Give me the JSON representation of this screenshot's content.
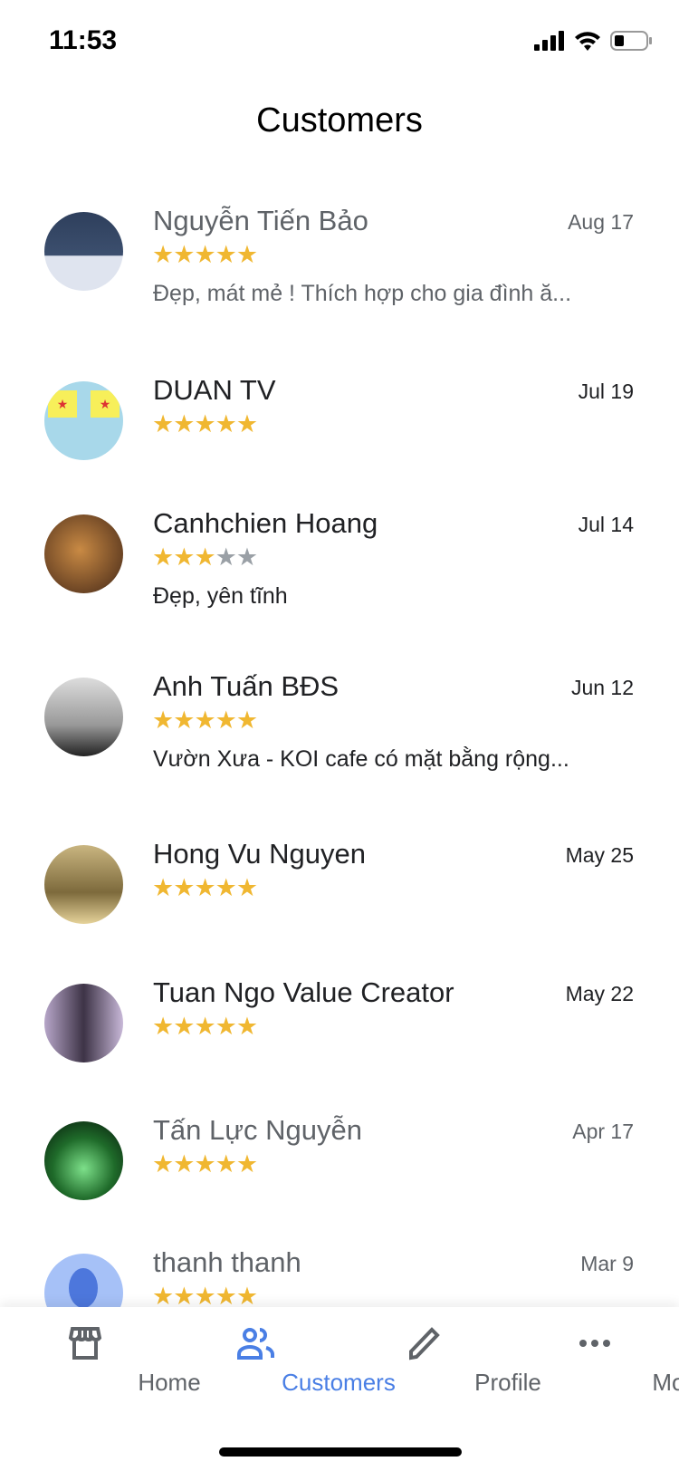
{
  "status_bar": {
    "time": "11:53"
  },
  "header": {
    "title": "Customers"
  },
  "colors": {
    "accent": "#4a7fe5",
    "star": "#f0b731",
    "star_empty": "#9aa0a6"
  },
  "customers": [
    {
      "name": "Nguyễn Tiến Bảo",
      "date": "Aug 17",
      "rating": 5,
      "review": "Đẹp, mát mẻ ! Thích hợp cho gia đình ă...",
      "style": "muted",
      "avatar": "photo-man-brick-wall"
    },
    {
      "name": "DUAN TV",
      "date": "Jul 19",
      "rating": 5,
      "review": "",
      "style": "dark",
      "avatar": "yellow-flags-red-stars"
    },
    {
      "name": "Canhchien Hoang",
      "date": "Jul 14",
      "rating": 3,
      "review": "Đẹp, yên tĩnh",
      "style": "dark",
      "avatar": "photo-tiger"
    },
    {
      "name": "Anh Tuấn BĐS",
      "date": "Jun 12",
      "rating": 5,
      "review": "Vườn Xưa - KOI cafe có mặt bằng rộng...",
      "style": "dark",
      "avatar": "photo-bw-person"
    },
    {
      "name": "Hong Vu Nguyen",
      "date": "May 25",
      "rating": 5,
      "review": "",
      "style": "dark",
      "avatar": "photo-couple"
    },
    {
      "name": "Tuan Ngo Value Creator",
      "date": "May 22",
      "rating": 5,
      "review": "",
      "style": "dark",
      "avatar": "photo-man-suit"
    },
    {
      "name": "Tấn Lực Nguyễn",
      "date": "Apr 17",
      "rating": 5,
      "review": "",
      "style": "muted",
      "avatar": "photo-fountain-green"
    },
    {
      "name": "thanh thanh",
      "date": "Mar 9",
      "rating": 5,
      "review": "",
      "style": "muted",
      "avatar": "default-person"
    }
  ],
  "bottom_nav": [
    {
      "label": "Home",
      "icon": "storefront-icon",
      "active": false
    },
    {
      "label": "Customers",
      "icon": "people-icon",
      "active": true
    },
    {
      "label": "Profile",
      "icon": "pencil-icon",
      "active": false
    },
    {
      "label": "More",
      "icon": "more-dots-icon",
      "active": false
    }
  ]
}
